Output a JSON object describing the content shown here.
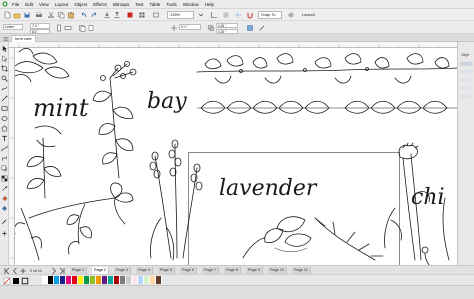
{
  "menu": {
    "items": [
      "File",
      "Edit",
      "View",
      "Layout",
      "Object",
      "Effects",
      "Bitmaps",
      "Text",
      "Table",
      "Tools",
      "Window",
      "Help"
    ]
  },
  "toolbar": {
    "zoom_value": "135%",
    "snap_label": "Snap To",
    "launch_label": "Launch",
    "units_label": "Units: inches",
    "x_value": "7.0 \"",
    "y_value": "8.5 \"",
    "nudge_value": "0.1 \"",
    "dup_x": "0.25 \"",
    "dup_y": "0.25 \"",
    "page_size": "Letter"
  },
  "document": {
    "tab_label": "herb cafe"
  },
  "canvas_text": {
    "mint": "mint",
    "bay": "bay",
    "lavender": "lavender",
    "chives_partial": "chi"
  },
  "page_nav": {
    "count_label": "2 of 11",
    "pages": [
      "Page 1",
      "Page 2",
      "Page 3",
      "Page 4",
      "Page 5",
      "Page 6",
      "Page 7",
      "Page 8",
      "Page 9",
      "Page 10",
      "Page 11"
    ],
    "active_page": "Page 2"
  },
  "docker": {
    "title": "Obje"
  },
  "palette": {
    "colors": [
      "#ffffff",
      "#000000",
      "#00a0e9",
      "#1d2088",
      "#e4007f",
      "#e60012",
      "#fff100",
      "#009944",
      "#8fc31f",
      "#f39800",
      "#601986",
      "#00a29a",
      "#a40000",
      "#7d7d7d",
      "#c9c9c9",
      "#ffe4f0",
      "#b5d7ff",
      "#d8f0c8",
      "#ffd9a8",
      "#5f3c23"
    ]
  },
  "status": {
    "text": ""
  }
}
